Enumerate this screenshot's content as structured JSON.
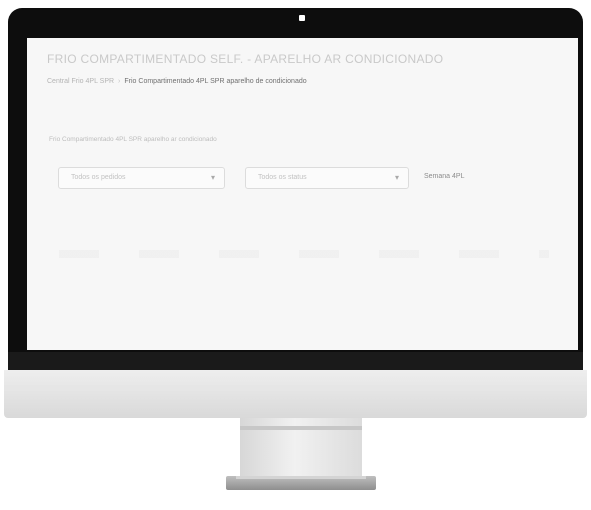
{
  "screen": {
    "page_title": "FRIO COMPARTIMENTADO SELF. - APARELHO AR CONDICIONADO",
    "breadcrumb": {
      "home": "Central Frio 4PL SPR",
      "current": "Frio Compartimentado 4PL SPR aparelho de condicionado"
    },
    "filter_label": "Frio Compartimentado 4PL SPR aparelho ar condicionado",
    "select_1": {
      "value": "Todos os pedidos"
    },
    "select_2": {
      "value": "Todos os status"
    },
    "side_text": "Semana 4PL"
  },
  "icons": {
    "dropdown": "chevron-down-icon",
    "camera": "camera-dot"
  },
  "colors": {
    "bezel": "#0d0d0d",
    "screen_bg": "#f7f7f7",
    "monitor_silver": "#e0e0e0"
  }
}
